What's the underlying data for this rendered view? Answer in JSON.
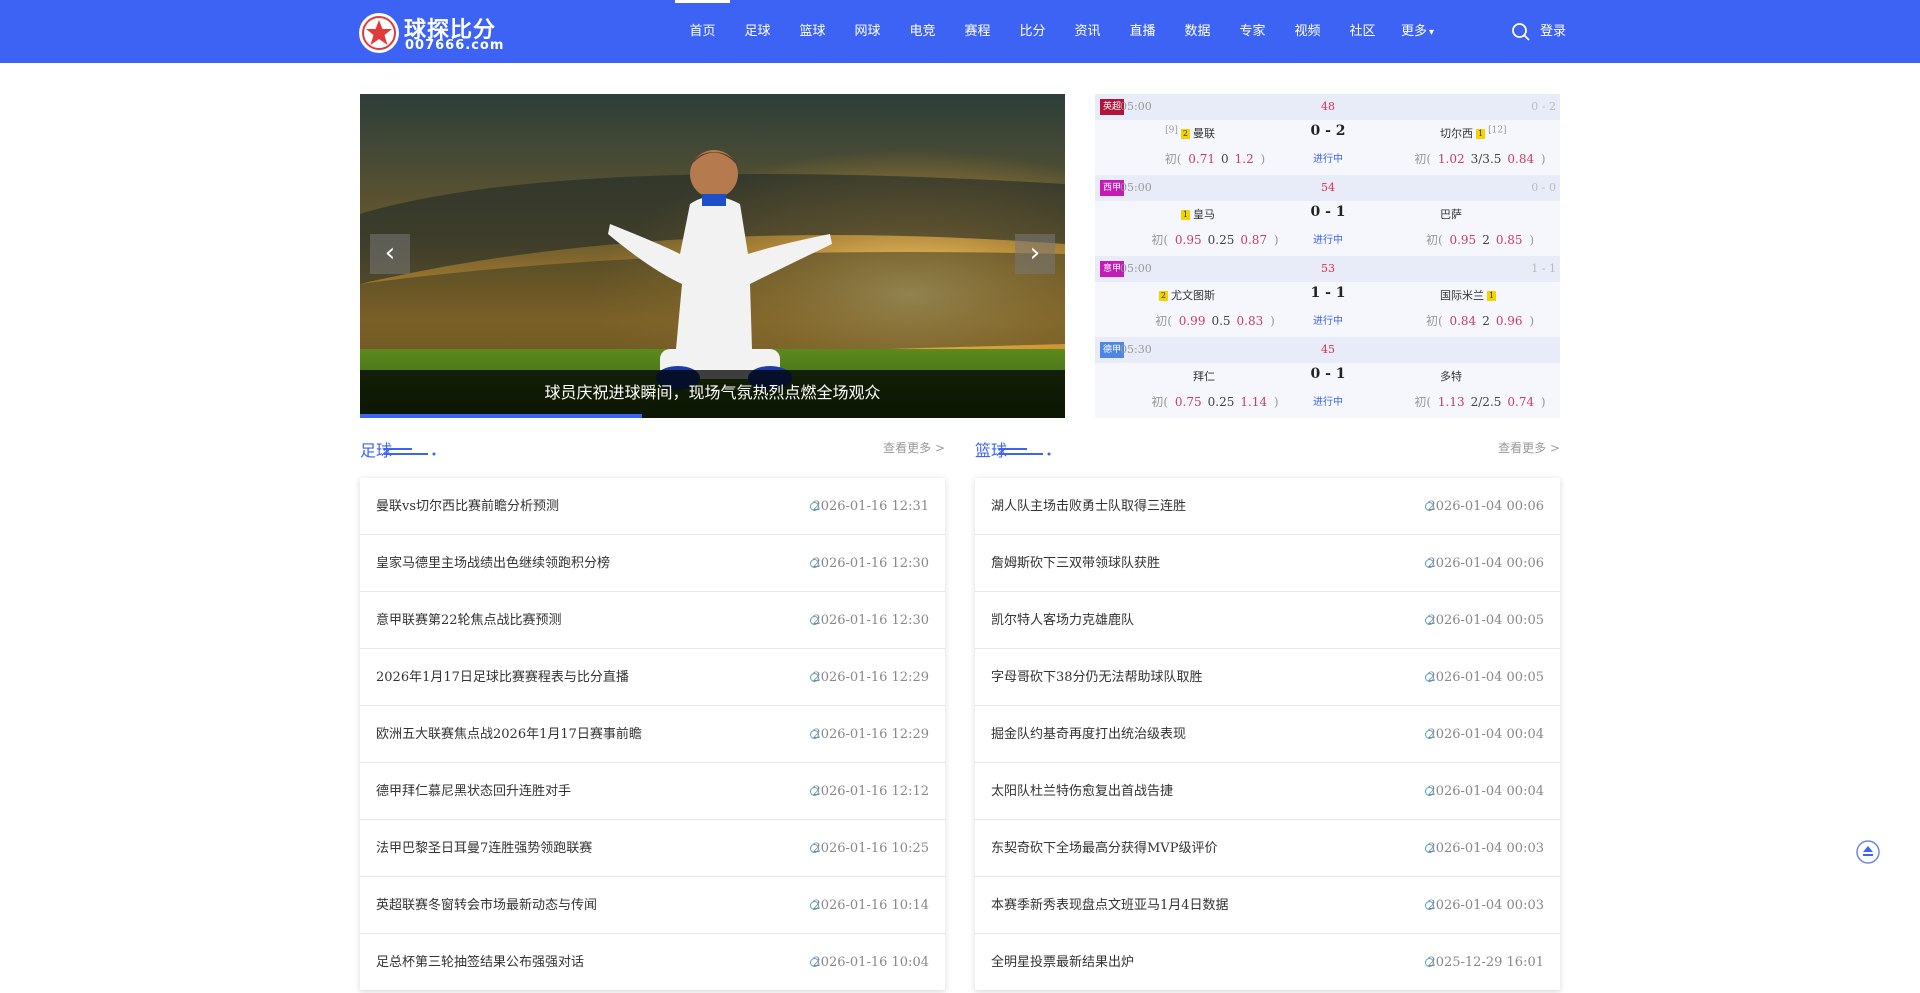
{
  "header": {
    "logo_title": "球探比分",
    "logo_domain": "007666.com",
    "nav": [
      "首页",
      "足球",
      "篮球",
      "网球",
      "电竞",
      "赛程",
      "比分",
      "资讯",
      "直播",
      "数据",
      "专家",
      "视频",
      "社区",
      "更多"
    ],
    "more_arrow": "▾",
    "login": "登录",
    "brand_color": "#3d63f4"
  },
  "banner": {
    "caption": "球员庆祝进球瞬间，现场气氛热烈点燃全场观众",
    "prev": "‹",
    "next": "›",
    "progress": 0.4
  },
  "matches": [
    {
      "league": "英超",
      "league_color": "#b0143c",
      "time": "05:00",
      "minute": "48",
      "ht": "0 - 2",
      "home": "曼联",
      "home_rank": "[9]",
      "home_cards": "2",
      "away": "切尔西",
      "away_rank": "[12]",
      "away_cards": "1",
      "score": "0 - 2",
      "status": "进行中",
      "home_odds": [
        "0.71",
        "0",
        "1.2"
      ],
      "away_odds": [
        "1.02",
        "3/3.5",
        "0.84"
      ]
    },
    {
      "league": "西甲",
      "league_color": "#c41ab8",
      "time": "05:00",
      "minute": "54",
      "ht": "0 - 0",
      "home": "皇马",
      "home_cards": "1",
      "away": "巴萨",
      "score": "0 - 1",
      "status": "进行中",
      "home_odds": [
        "0.95",
        "0.25",
        "0.87"
      ],
      "away_odds": [
        "0.95",
        "2",
        "0.85"
      ]
    },
    {
      "league": "意甲",
      "league_color": "#c41ab8",
      "time": "05:00",
      "minute": "53",
      "ht": "1 - 1",
      "home": "尤文图斯",
      "home_cards": "2",
      "away": "国际米兰",
      "away_cards": "1",
      "score": "1 - 1",
      "status": "进行中",
      "home_odds": [
        "0.99",
        "0.5",
        "0.83"
      ],
      "away_odds": [
        "0.84",
        "2",
        "0.96"
      ]
    },
    {
      "league": "德甲",
      "league_color": "#4f86e6",
      "time": "05:30",
      "minute": "45",
      "ht": "",
      "home": "拜仁",
      "away": "多特",
      "score": "0 - 1",
      "status": "进行中",
      "home_odds": [
        "0.75",
        "0.25",
        "1.14"
      ],
      "away_odds": [
        "1.13",
        "2/2.5",
        "0.74"
      ]
    }
  ],
  "odds_prefix": "初",
  "left_column": {
    "title": "足球",
    "more": "查看更多 >",
    "items": [
      {
        "title": "曼联vs切尔西比赛前瞻分析预测",
        "date": "2026-01-16 12:31"
      },
      {
        "title": "皇家马德里主场战绩出色继续领跑积分榜",
        "date": "2026-01-16 12:30"
      },
      {
        "title": "意甲联赛第22轮焦点战比赛预测",
        "date": "2026-01-16 12:30"
      },
      {
        "title": "2026年1月17日足球比赛赛程表与比分直播",
        "date": "2026-01-16 12:29"
      },
      {
        "title": "欧洲五大联赛焦点战2026年1月17日赛事前瞻",
        "date": "2026-01-16 12:29"
      },
      {
        "title": "德甲拜仁慕尼黑状态回升连胜对手",
        "date": "2026-01-16 12:12"
      },
      {
        "title": "法甲巴黎圣日耳曼7连胜强势领跑联赛",
        "date": "2026-01-16 10:25"
      },
      {
        "title": "英超联赛冬窗转会市场最新动态与传闻",
        "date": "2026-01-16 10:14"
      },
      {
        "title": "足总杯第三轮抽签结果公布强强对话",
        "date": "2026-01-16 10:04"
      }
    ]
  },
  "right_column": {
    "title": "篮球",
    "more": "查看更多 >",
    "items": [
      {
        "title": "湖人队主场击败勇士队取得三连胜",
        "date": "2026-01-04 00:06"
      },
      {
        "title": "詹姆斯砍下三双带领球队获胜",
        "date": "2026-01-04 00:06"
      },
      {
        "title": "凯尔特人客场力克雄鹿队",
        "date": "2026-01-04 00:05"
      },
      {
        "title": "字母哥砍下38分仍无法帮助球队取胜",
        "date": "2026-01-04 00:05"
      },
      {
        "title": "掘金队约基奇再度打出统治级表现",
        "date": "2026-01-04 00:04"
      },
      {
        "title": "太阳队杜兰特伤愈复出首战告捷",
        "date": "2026-01-04 00:04"
      },
      {
        "title": "东契奇砍下全场最高分获得MVP级评价",
        "date": "2026-01-04 00:03"
      },
      {
        "title": "本赛季新秀表现盘点文班亚马1月4日数据",
        "date": "2026-01-04 00:03"
      },
      {
        "title": "全明星投票最新结果出炉",
        "date": "2025-12-29 16:01"
      }
    ]
  }
}
